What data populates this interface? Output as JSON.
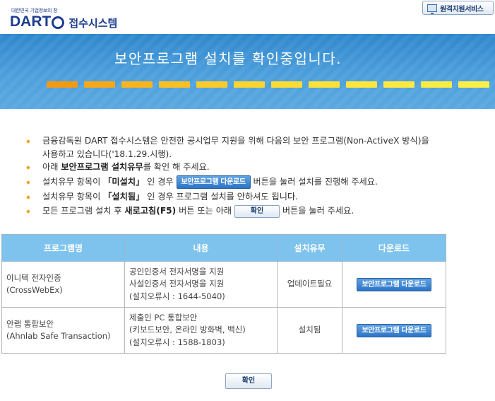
{
  "header": {
    "slogan": "대한민국 기업정보의 창",
    "logo_text": "DART",
    "system_name": "접수시스템",
    "remote_service_label": "원격지원서비스"
  },
  "banner": {
    "title": "보안프로그램 설치를 확인중입니다.",
    "progress_colors": [
      "#f39a14",
      "#f6a81a",
      "#f8b41f",
      "#f9c024",
      "#facb2a",
      "#fbd42f",
      "#fbdc34",
      "#fce238",
      "#fce63c",
      "#fde93f",
      "#fdec42",
      "#fdef46"
    ]
  },
  "notice": {
    "item1_line1": "금융감독원 DART 접수시스템은 안전한 공시업무 지원을 위해 다음의 보안 프로그램(Non-ActiveX 방식)을",
    "item1_line2": "사용하고 있습니다('18.1.29.시행).",
    "item2_pre": "아래 ",
    "item2_bold": "보안프로그램 설치유무",
    "item2_post": "를 확인 해 주세요.",
    "item3_pre": "설치유무 항목이 ",
    "item3_bold": "「미설치」",
    "item3_mid": " 인 경우 ",
    "item3_button": "보안프로그램 다운로드",
    "item3_post": " 버튼을 눌러 설치를 진행해 주세요.",
    "item4_pre": "설치유무 항목이 ",
    "item4_bold": "「설치됨」",
    "item4_post": " 인 경우 프로그램 설치를 안하셔도 됩니다.",
    "item5_pre": "모든 프로그램 설치 후 ",
    "item5_bold": "새로고침(F5)",
    "item5_mid": " 버튼 또는 아래 ",
    "item5_button": "확인",
    "item5_post": " 버튼을 눌러 주세요."
  },
  "table": {
    "headers": [
      "프로그램명",
      "내용",
      "설치유무",
      "다운로드"
    ],
    "rows": [
      {
        "name_line1": "이니텍 전자인증",
        "name_line2": "(CrossWebEx)",
        "desc_line1": "공인인증서 전자서명을 지원",
        "desc_line2": "사설인증서 전자서명을 지원",
        "desc_line3": "(설치오류시 : 1644-5040)",
        "status": "업데이트필요",
        "download_label": "보안프로그램 다운로드"
      },
      {
        "name_line1": "안랩 통합보안",
        "name_line2": "(Ahnlab Safe Transaction)",
        "desc_line1": "제출인 PC 통합보안",
        "desc_line2": "(키보드보안, 온라인 방화벽, 백신)",
        "desc_line3": "(설치오류시 : 1588-1803)",
        "status": "설치됨",
        "download_label": "보안프로그램 다운로드"
      }
    ]
  },
  "confirm_label": "확인"
}
